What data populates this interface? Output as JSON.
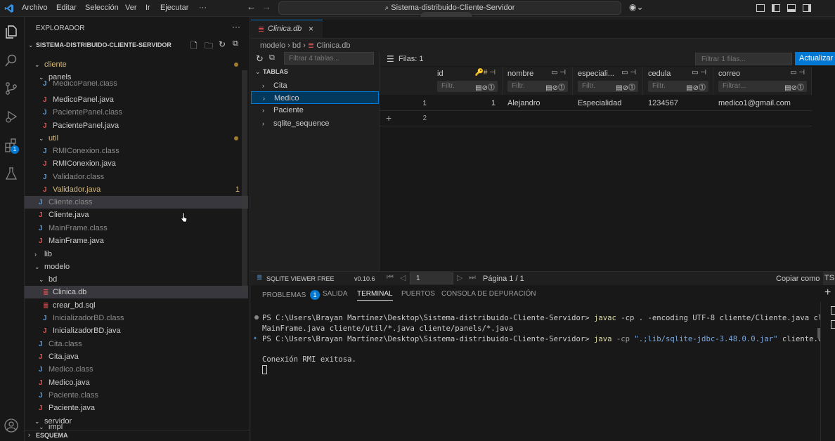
{
  "menu": {
    "archivo": "Archivo",
    "editar": "Editar",
    "seleccion": "Selección",
    "ver": "Ver",
    "ir": "Ir",
    "ejecutar": "Ejecutar",
    "more": "···"
  },
  "command_center": "Sistema-distribuido-Cliente-Servidor",
  "explorer": {
    "title": "EXPLORADOR",
    "root": "SISTEMA-DISTRIBUIDO-CLIENTE-SERVIDOR",
    "items": [
      {
        "label": "cliente"
      },
      {
        "label": "panels"
      },
      {
        "label": "MedicoPanel.class"
      },
      {
        "label": "MedicoPanel.java"
      },
      {
        "label": "PacientePanel.class"
      },
      {
        "label": "PacientePanel.java"
      },
      {
        "label": "util"
      },
      {
        "label": "RMIConexion.class"
      },
      {
        "label": "RMIConexion.java"
      },
      {
        "label": "Validador.class"
      },
      {
        "label": "Validador.java",
        "badge": "1"
      },
      {
        "label": "Cliente.class"
      },
      {
        "label": "Cliente.java"
      },
      {
        "label": "MainFrame.class"
      },
      {
        "label": "MainFrame.java"
      },
      {
        "label": "lib"
      },
      {
        "label": "modelo"
      },
      {
        "label": "bd"
      },
      {
        "label": "Clinica.db"
      },
      {
        "label": "crear_bd.sql"
      },
      {
        "label": "InicializadorBD.class"
      },
      {
        "label": "InicializadorBD.java"
      },
      {
        "label": "Cita.class"
      },
      {
        "label": "Cita.java"
      },
      {
        "label": "Medico.class"
      },
      {
        "label": "Medico.java"
      },
      {
        "label": "Paciente.class"
      },
      {
        "label": "Paciente.java"
      },
      {
        "label": "servidor"
      },
      {
        "label": "impl"
      }
    ],
    "esquema": "ESQUEMA"
  },
  "tab": {
    "label": "Clinica.db"
  },
  "breadcrumb": {
    "a": "modelo",
    "b": "bd",
    "c": "Clinica.db"
  },
  "viewer": {
    "filter_tables_placeholder": "Filtrar 4 tablas...",
    "tables_header": "TABLAS",
    "tables": [
      "Cita",
      "Medico",
      "Paciente",
      "sqlite_sequence"
    ],
    "rows_label": "Filas: 1",
    "filter_rows_placeholder": "Filtrar 1 filas...",
    "refresh_button": "Actualizar",
    "columns": [
      {
        "name": "id",
        "filter": "Filtr."
      },
      {
        "name": "nombre",
        "filter": "Filtr."
      },
      {
        "name": "especiali...",
        "filter": "Filtr."
      },
      {
        "name": "cedula",
        "filter": "Filtr."
      },
      {
        "name": "correo",
        "filter": "Filtrar..."
      }
    ],
    "rows": [
      {
        "num": "1",
        "id": "1",
        "nombre": "Alejandro",
        "especialidad": "Especialidad",
        "cedula": "1234567",
        "correo": "medico1@gmail.com"
      }
    ],
    "new_row_num": "2",
    "brand": "SQLITE VIEWER FREE",
    "version": "v0.10.6",
    "page_input": "1",
    "page_label": "Página 1 / 1",
    "copy_label": "Copiar como",
    "ts_label": "TS"
  },
  "panel": {
    "problemas": "PROBLEMAS",
    "problemas_count": "1",
    "salida": "SALIDA",
    "terminal": "TERMINAL",
    "puertos": "PUERTOS",
    "consola": "CONSOLA DE DEPURACIÓN"
  },
  "terminal": {
    "line1_prefix": "PS C:\\Users\\Brayan Martínez\\Desktop\\Sistema-distribuido-Cliente-Servidor> ",
    "line1_cmd": "javac",
    "line1_rest": " -cp . -encoding UTF-8 cliente/Cliente.java cliente/",
    "line2": "MainFrame.java cliente/util/*.java cliente/panels/*.java",
    "line3_prefix": "PS C:\\Users\\Brayan Martínez\\Desktop\\Sistema-distribuido-Cliente-Servidor> ",
    "line3_cmd": "java",
    "line3_opt": " -cp ",
    "line3_str": "\".;lib/sqlite-jdbc-3.48.0.0.jar\"",
    "line3_rest": " cliente.Cliente",
    "line4": "Conexión RMI exitosa."
  },
  "colors": {
    "accent": "#0078d4",
    "java_icon": "#e05252",
    "class_icon": "#5b9bd5",
    "modified": "#d7ba7d",
    "cmd_yellow": "#dcdcaa",
    "str_blue": "#7ca9e0"
  }
}
